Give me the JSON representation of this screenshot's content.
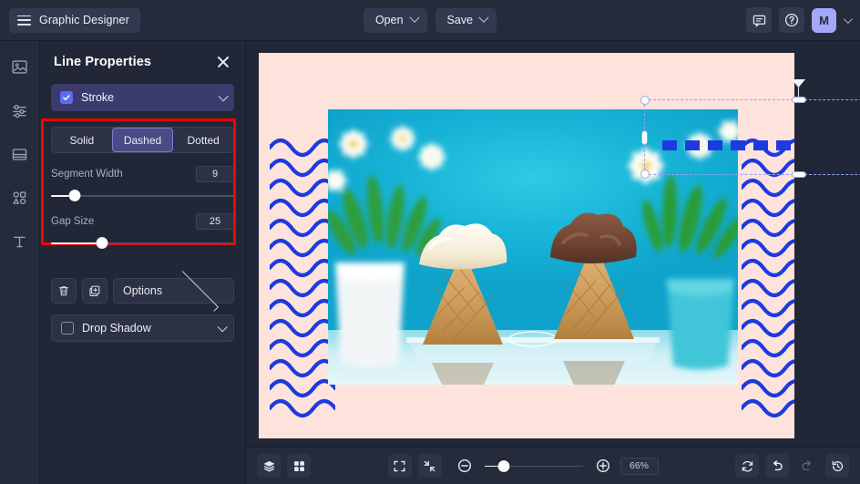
{
  "app": {
    "brand": "Graphic Designer",
    "menu_icon": "hamburger-icon"
  },
  "topbar": {
    "open_label": "Open",
    "save_label": "Save",
    "comment_icon": "comment-icon",
    "help_icon": "help-circle-icon",
    "avatar_initial": "M",
    "accent_color": "#a3a8fb"
  },
  "rail": {
    "items": [
      {
        "icon": "image-icon",
        "name": "rail-item-image"
      },
      {
        "icon": "sliders-icon",
        "name": "rail-item-adjust"
      },
      {
        "icon": "layout-icon",
        "name": "rail-item-layout"
      },
      {
        "icon": "shapes-icon",
        "name": "rail-item-shapes"
      },
      {
        "icon": "text-icon",
        "name": "rail-item-text"
      }
    ]
  },
  "panel": {
    "title": "Line Properties",
    "close_icon": "close-icon",
    "stroke": {
      "label": "Stroke",
      "checked": true,
      "chevron_icon": "chevron-down-icon",
      "highlight_color": "#ff0000"
    },
    "style_tabs": {
      "options": [
        "Solid",
        "Dashed",
        "Dotted"
      ],
      "selected": "Dashed"
    },
    "sliders": [
      {
        "label": "Segment Width",
        "value": "9",
        "percent": 13
      },
      {
        "label": "Gap Size",
        "value": "25",
        "percent": 28
      }
    ],
    "actions": {
      "delete_icon": "trash-icon",
      "duplicate_icon": "duplicate-icon",
      "options_label": "Options",
      "options_chevron_icon": "chevron-right-icon"
    },
    "drop_shadow": {
      "label": "Drop Shadow",
      "checked": false,
      "chevron_icon": "chevron-down-icon"
    }
  },
  "canvas": {
    "background_color": "#fde3dc",
    "wave_color": "#1d3ae0",
    "selected_line": {
      "color": "#1d3ae0",
      "style": "dashed"
    },
    "photo_alt": "two ice cream cones vanilla and chocolate on clear stand with cyan background and daisies"
  },
  "bottombar": {
    "layers_icon": "layers-icon",
    "grid_icon": "grid-icon",
    "fit_icon": "fit-screen-icon",
    "shrink_icon": "shrink-icon",
    "zoom_out_icon": "zoom-out-icon",
    "zoom_in_icon": "zoom-in-icon",
    "zoom_level": "66%",
    "zoom_percent": 20,
    "refresh_icon": "refresh-icon",
    "undo_icon": "undo-icon",
    "redo_icon": "redo-icon",
    "history_icon": "history-icon"
  }
}
